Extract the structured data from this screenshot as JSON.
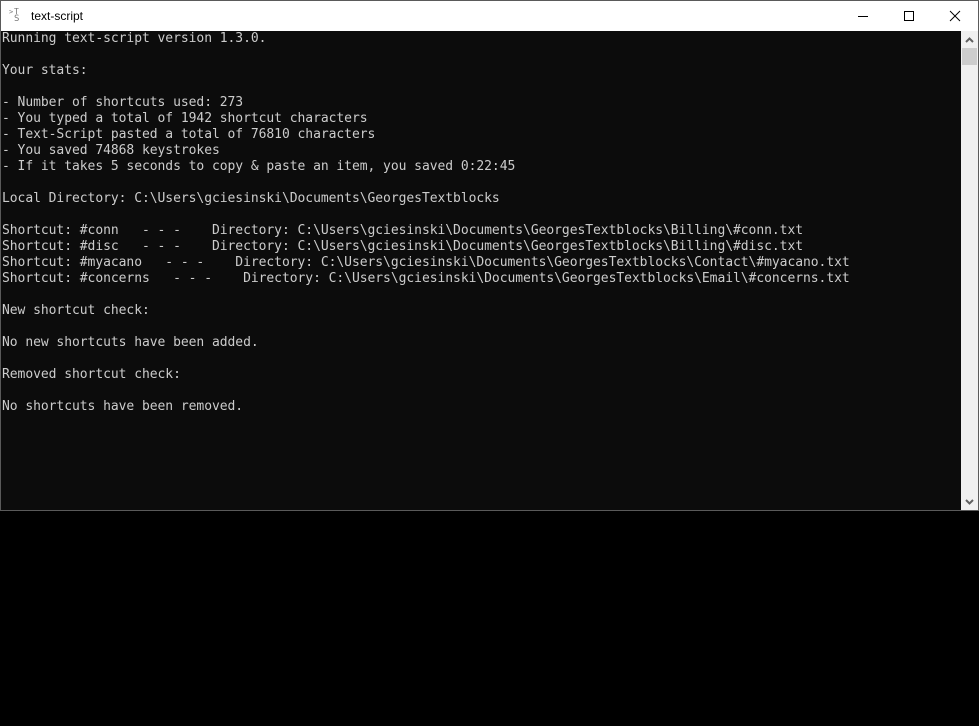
{
  "window": {
    "title": "text-script",
    "app_icon": "console-app-icon",
    "controls": {
      "minimize": "minimize-icon",
      "maximize": "maximize-icon",
      "close": "close-icon"
    }
  },
  "console": {
    "lines": [
      "Running text-script version 1.3.0.",
      "",
      "Your stats:",
      "",
      "- Number of shortcuts used: 273",
      "- You typed a total of 1942 shortcut characters",
      "- Text-Script pasted a total of 76810 characters",
      "- You saved 74868 keystrokes",
      "- If it takes 5 seconds to copy & paste an item, you saved 0:22:45",
      "",
      "Local Directory: C:\\Users\\gciesinski\\Documents\\GeorgesTextblocks",
      "",
      "Shortcut: #conn   - - -    Directory: C:\\Users\\gciesinski\\Documents\\GeorgesTextblocks\\Billing\\#conn.txt",
      "Shortcut: #disc   - - -    Directory: C:\\Users\\gciesinski\\Documents\\GeorgesTextblocks\\Billing\\#disc.txt",
      "Shortcut: #myacano   - - -    Directory: C:\\Users\\gciesinski\\Documents\\GeorgesTextblocks\\Contact\\#myacano.txt",
      "Shortcut: #concerns   - - -    Directory: C:\\Users\\gciesinski\\Documents\\GeorgesTextblocks\\Email\\#concerns.txt",
      "",
      "New shortcut check:",
      "",
      "No new shortcuts have been added.",
      "",
      "Removed shortcut check:",
      "",
      "No shortcuts have been removed."
    ]
  },
  "colors": {
    "console_bg": "#0c0c0c",
    "console_fg": "#cccccc",
    "titlebar_bg": "#ffffff",
    "scrollbar_bg": "#f0f0f0",
    "scrollbar_thumb": "#cdcdcd"
  }
}
